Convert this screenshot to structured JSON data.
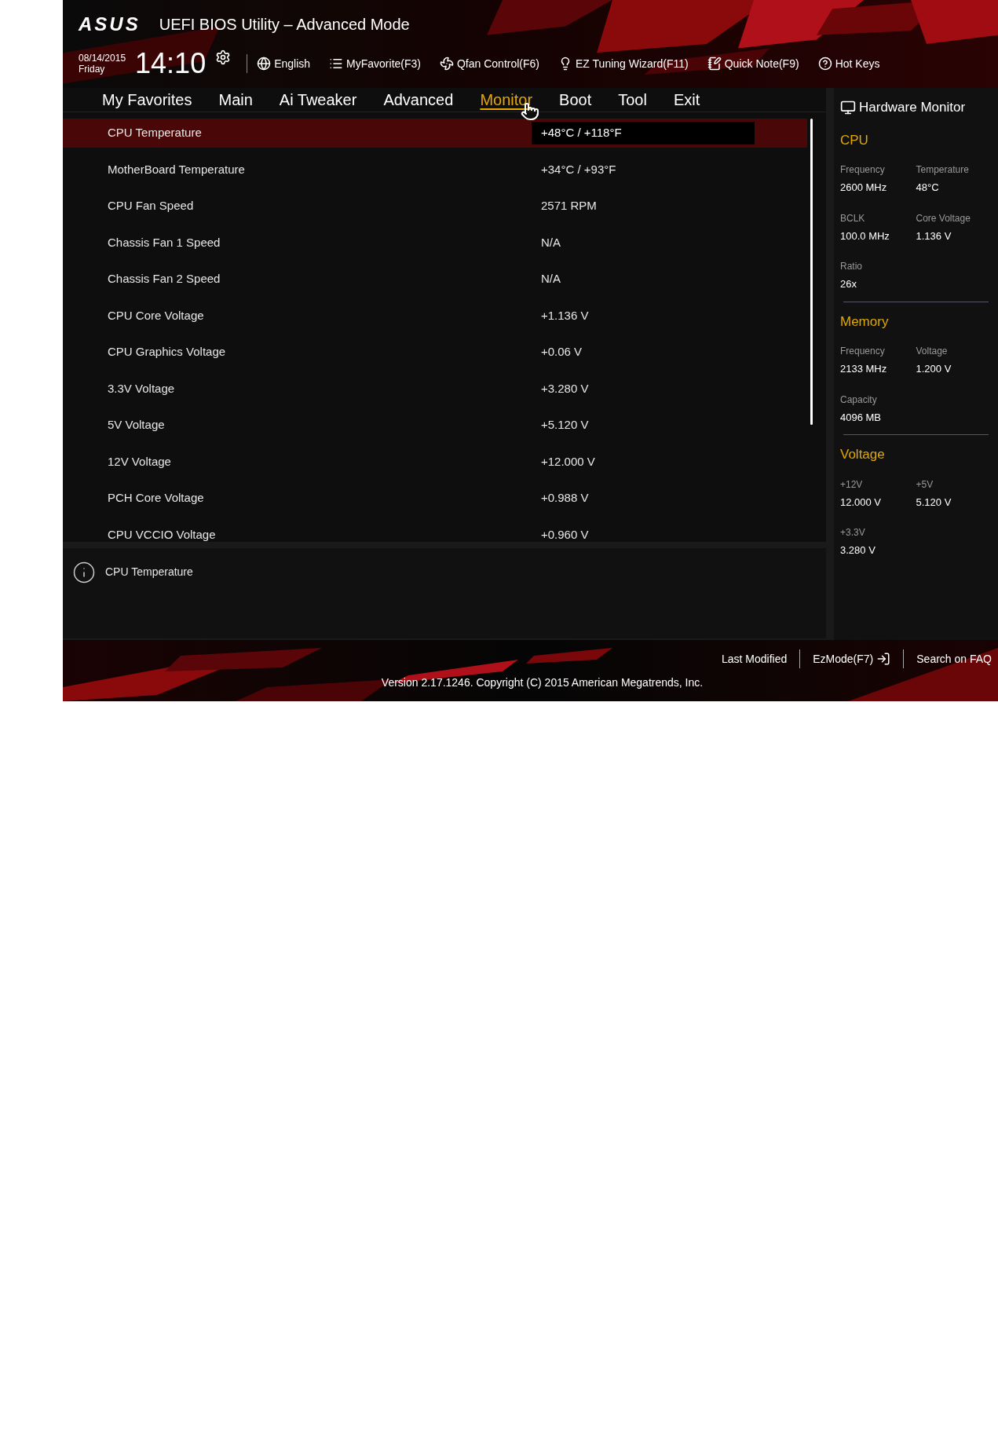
{
  "header": {
    "logo": "ASUS",
    "title": "UEFI BIOS Utility – Advanced Mode",
    "date": "08/14/2015",
    "day": "Friday",
    "time": "14:10"
  },
  "toolbar": [
    {
      "label": "English"
    },
    {
      "label": "MyFavorite(F3)"
    },
    {
      "label": "Qfan Control(F6)"
    },
    {
      "label": "EZ Tuning Wizard(F11)"
    },
    {
      "label": "Quick Note(F9)"
    },
    {
      "label": "Hot Keys"
    }
  ],
  "tabs": [
    {
      "label": "My Favorites",
      "selected": false
    },
    {
      "label": "Main",
      "selected": false
    },
    {
      "label": "Ai Tweaker",
      "selected": false
    },
    {
      "label": "Advanced",
      "selected": false
    },
    {
      "label": "Monitor",
      "selected": true
    },
    {
      "label": "Boot",
      "selected": false
    },
    {
      "label": "Tool",
      "selected": false
    },
    {
      "label": "Exit",
      "selected": false
    }
  ],
  "rows": [
    {
      "label": "CPU Temperature",
      "value": "+48°C / +118°F",
      "selected": true
    },
    {
      "label": "MotherBoard Temperature",
      "value": "+34°C / +93°F",
      "selected": false
    },
    {
      "label": "CPU Fan Speed",
      "value": "2571 RPM",
      "selected": false
    },
    {
      "label": "Chassis Fan 1 Speed",
      "value": "N/A",
      "selected": false
    },
    {
      "label": "Chassis Fan 2 Speed",
      "value": "N/A",
      "selected": false
    },
    {
      "label": "CPU Core Voltage",
      "value": "+1.136 V",
      "selected": false
    },
    {
      "label": "CPU Graphics Voltage",
      "value": "+0.06 V",
      "selected": false
    },
    {
      "label": "3.3V Voltage",
      "value": "+3.280 V",
      "selected": false
    },
    {
      "label": "5V Voltage",
      "value": "+5.120 V",
      "selected": false
    },
    {
      "label": "12V Voltage",
      "value": "+12.000 V",
      "selected": false
    },
    {
      "label": "PCH Core Voltage",
      "value": "+0.988 V",
      "selected": false
    },
    {
      "label": "CPU VCCIO Voltage",
      "value": "+0.960 V",
      "selected": false
    }
  ],
  "help": {
    "text": "CPU Temperature"
  },
  "hardware_monitor": {
    "title": "Hardware Monitor",
    "sections": [
      {
        "title": "CPU",
        "items": [
          {
            "label": "Frequency",
            "value": "2600 MHz"
          },
          {
            "label": "Temperature",
            "value": "48°C"
          },
          {
            "label": "BCLK",
            "value": "100.0 MHz"
          },
          {
            "label": "Core Voltage",
            "value": "1.136 V"
          },
          {
            "label": "Ratio",
            "value": "26x"
          }
        ]
      },
      {
        "title": "Memory",
        "items": [
          {
            "label": "Frequency",
            "value": "2133 MHz"
          },
          {
            "label": "Voltage",
            "value": "1.200 V"
          },
          {
            "label": "Capacity",
            "value": "4096 MB"
          }
        ]
      },
      {
        "title": "Voltage",
        "items": [
          {
            "label": "+12V",
            "value": "12.000 V"
          },
          {
            "label": "+5V",
            "value": "5.120 V"
          },
          {
            "label": "+3.3V",
            "value": "3.280 V"
          }
        ]
      }
    ]
  },
  "footer": {
    "links": [
      {
        "label": "Last Modified"
      },
      {
        "label": "EzMode(F7)"
      },
      {
        "label": "Search on FAQ"
      }
    ],
    "version": "Version 2.17.1246. Copyright (C) 2015 American Megatrends, Inc."
  }
}
